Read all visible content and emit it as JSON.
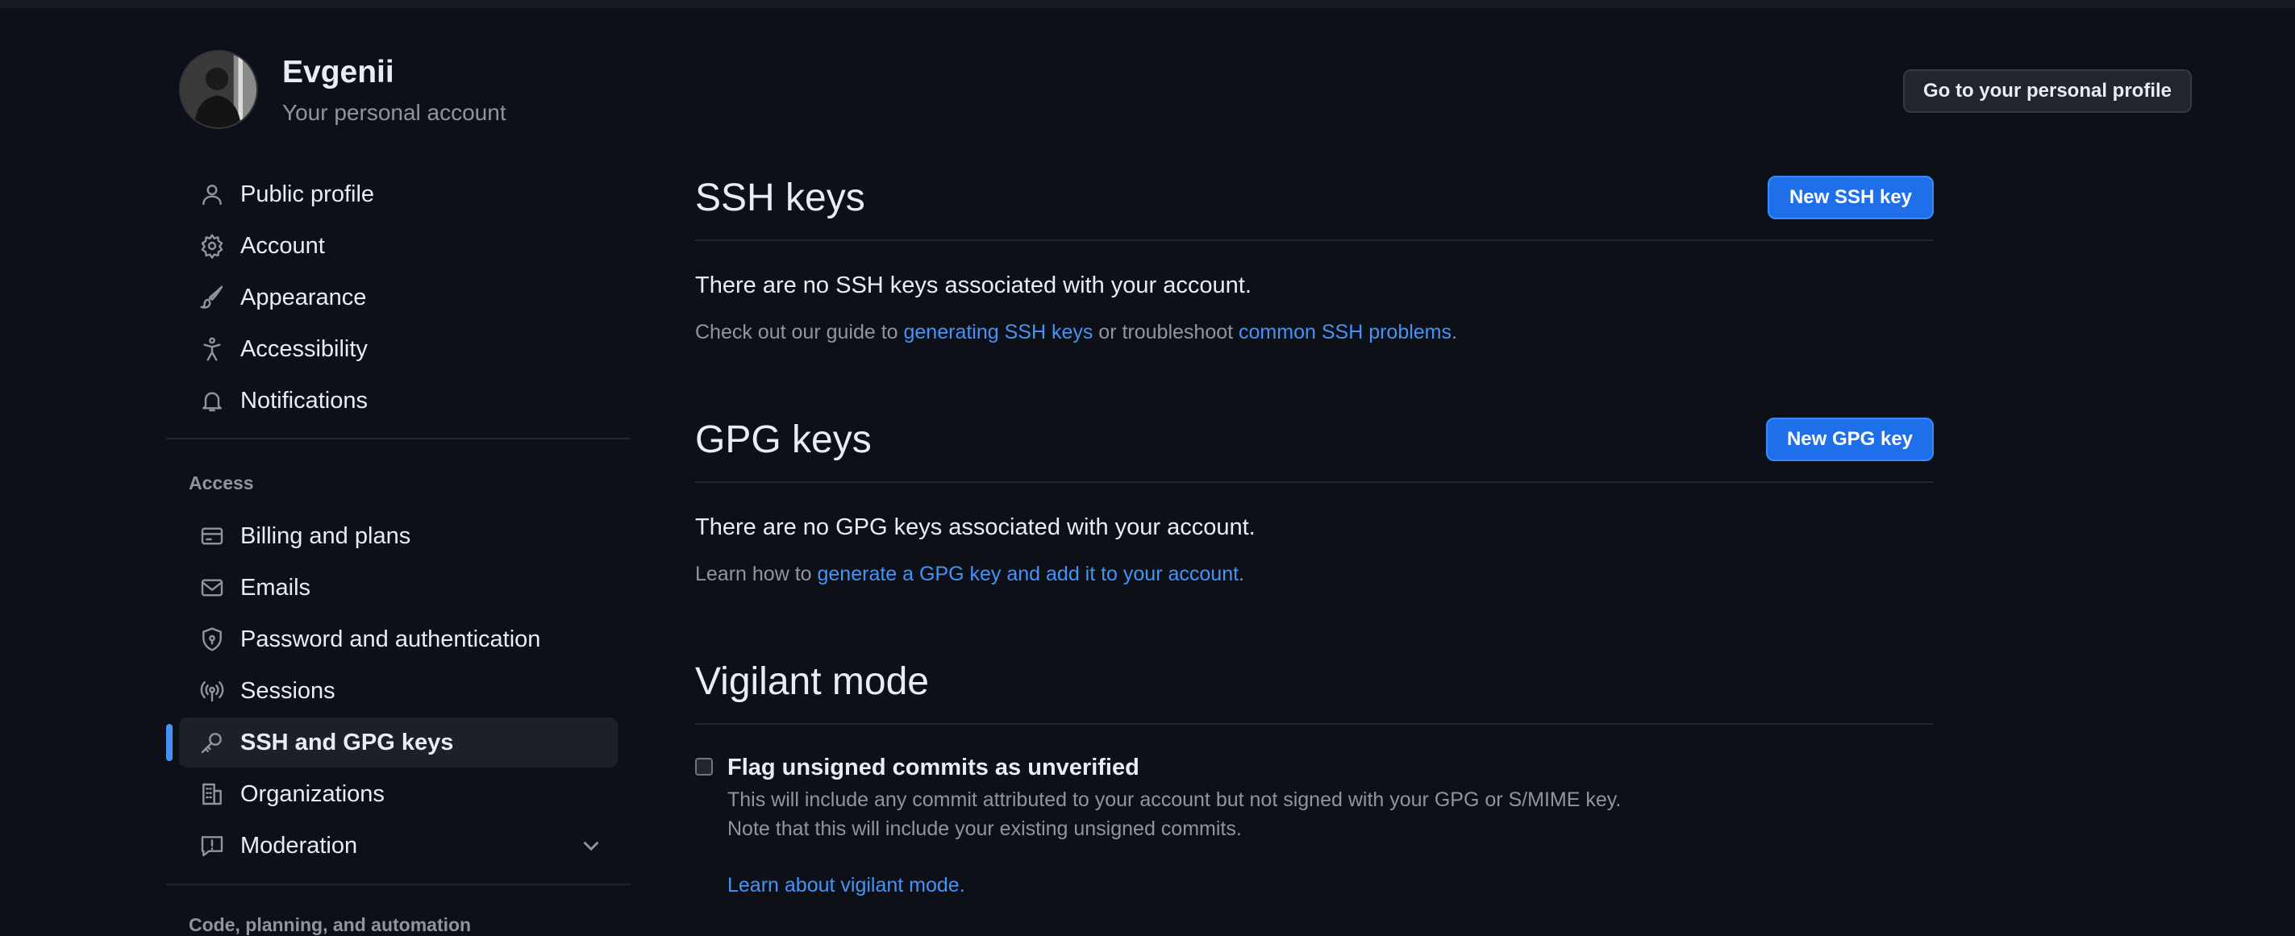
{
  "header": {
    "user_name": "Evgenii",
    "account_type": "Your personal account",
    "profile_button": "Go to your personal profile"
  },
  "sidebar": {
    "items": [
      {
        "label": "Public profile",
        "icon": "person-icon"
      },
      {
        "label": "Account",
        "icon": "gear-icon"
      },
      {
        "label": "Appearance",
        "icon": "paintbrush-icon"
      },
      {
        "label": "Accessibility",
        "icon": "accessibility-icon"
      },
      {
        "label": "Notifications",
        "icon": "bell-icon"
      }
    ],
    "access_section_label": "Access",
    "access_items": [
      {
        "label": "Billing and plans",
        "icon": "credit-card-icon"
      },
      {
        "label": "Emails",
        "icon": "mail-icon"
      },
      {
        "label": "Password and authentication",
        "icon": "shield-lock-icon"
      },
      {
        "label": "Sessions",
        "icon": "broadcast-icon"
      },
      {
        "label": "SSH and GPG keys",
        "icon": "key-icon",
        "active": true
      },
      {
        "label": "Organizations",
        "icon": "organization-icon"
      },
      {
        "label": "Moderation",
        "icon": "report-icon",
        "expandable": true
      }
    ],
    "next_section_label": "Code, planning, and automation"
  },
  "ssh": {
    "title": "SSH keys",
    "button": "New SSH key",
    "empty_text": "There are no SSH keys associated with your account.",
    "hint_prefix": "Check out our guide to ",
    "hint_link1": "generating SSH keys",
    "hint_middle": " or troubleshoot ",
    "hint_link2": "common SSH problems",
    "hint_suffix": "."
  },
  "gpg": {
    "title": "GPG keys",
    "button": "New GPG key",
    "empty_text": "There are no GPG keys associated with your account.",
    "hint_prefix": "Learn how to ",
    "hint_link": "generate a GPG key and add it to your account",
    "hint_suffix": "."
  },
  "vigilant": {
    "title": "Vigilant mode",
    "checkbox_label": "Flag unsigned commits as unverified",
    "checked": false,
    "desc_line1": "This will include any commit attributed to your account but not signed with your GPG or S/MIME key.",
    "desc_line2": "Note that this will include your existing unsigned commits.",
    "learn_link": "Learn about vigilant mode."
  },
  "colors": {
    "background": "#0d1117",
    "link": "#4493f8",
    "primary_button": "#1f6feb",
    "active_indicator": "#4493f8",
    "muted_text": "#8d96a0"
  }
}
